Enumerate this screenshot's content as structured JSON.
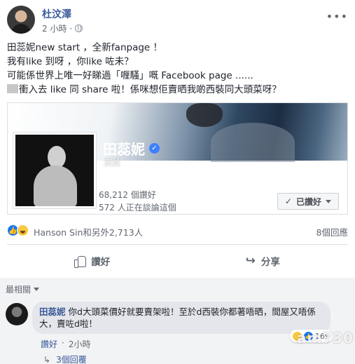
{
  "post": {
    "author": "杜汶澤",
    "time": "2 小時",
    "lines": [
      "田蕊妮new start ，全新fanpage ！",
      "我有like 到呀 ，你like 咗未？",
      "可能係世界上唯一好睇過「喱騷」嘅 Facebook page ......",
      "衝入去 like 同 share 啦！係咪想佢賣晒我啲西裝同大頭菜呀？"
    ]
  },
  "shared_page": {
    "name": "田蕊妮",
    "category": "演員",
    "likes": "68,212 個讚好",
    "talking": "572 人正在談論這個",
    "liked_button": "已讚好"
  },
  "reactions": {
    "names": "Hanson Sin和另外2,713人",
    "comments": "8個回應"
  },
  "actions": {
    "like": "讚好",
    "share": "分享"
  },
  "comments": {
    "sort_label": "最相關",
    "items": [
      {
        "author": "田蕊妮",
        "text": "你d大頭菜價好就要賣架啦！至於d西裝你都著唔晒，間屋又唔係大，賣咗d啦！",
        "reaction_count": "169",
        "like_label": "讚好",
        "time": "2小時",
        "replies": "3個回覆"
      }
    ]
  },
  "watermark": "am730",
  "colors": {
    "link": "#385898",
    "like_blue": "#1877f2",
    "comment_bg": "#f2f3f5"
  }
}
